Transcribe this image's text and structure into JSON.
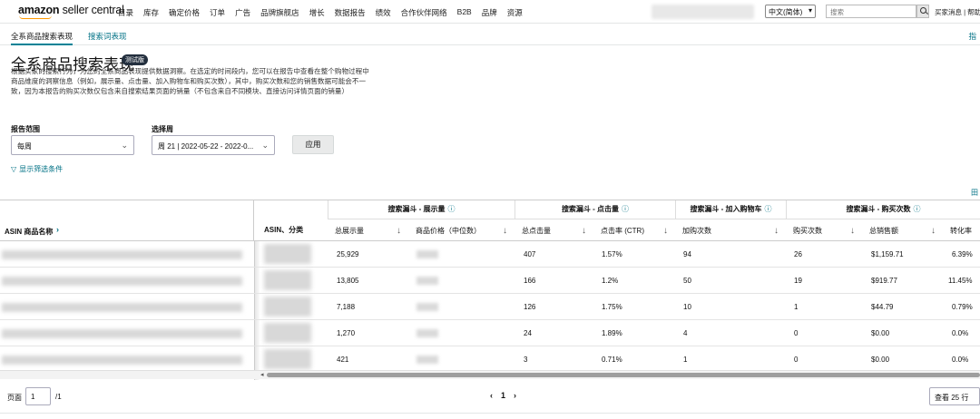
{
  "nav": {
    "logo_brand": "amazon",
    "logo_product": "seller central",
    "menu": [
      "目录",
      "库存",
      "确定价格",
      "订单",
      "广告",
      "品牌旗舰店",
      "增长",
      "数据报告",
      "绩效",
      "合作伙伴网络",
      "B2B",
      "品牌",
      "资源"
    ],
    "language": "中文(简体)",
    "search_placeholder": "搜索",
    "right_links": "买家消息 | 帮助"
  },
  "subnav": {
    "tabs": [
      "全系商品搜索表现",
      "搜索词表现"
    ],
    "active_tab": 0,
    "right_link": "指"
  },
  "header": {
    "title": "全系商品搜索表现",
    "badge": "测试版",
    "description": "根据买家的搜索行为，为您的全系商品表现提供数据洞察。在选定的时间段内，您可以在报告中查看在整个购物过程中商品维度的洞察信息（例如，展示量、点击量、加入购物车和购买次数），其中，购买次数和您的销售数据可能会不一致，因为本报告的购买次数仅包含来自搜索结果页面的销量（不包含来自不同模块、直接访问详情页面的销量）"
  },
  "filters": {
    "range_label": "报告范围",
    "range_value": "每周",
    "week_label": "选择周",
    "week_value": "周 21 | 2022-05-22 - 2022-0...",
    "apply_label": "应用",
    "show_filters_label": "显示筛选条件",
    "grid_icon_label": "田"
  },
  "table": {
    "asin_header": "ASIN 商品名称",
    "category_header": "ASIN、分类",
    "groups": [
      {
        "label": "搜索漏斗 - 展示量"
      },
      {
        "label": "搜索漏斗 - 点击量"
      },
      {
        "label": "搜索漏斗 - 加入购物车"
      },
      {
        "label": "搜索漏斗 - 购买次数"
      }
    ],
    "columns": [
      "总展示量",
      "商品价格（中位数）",
      "总点击量",
      "点击率 (CTR)",
      "加购次数",
      "购买次数",
      "总销售额",
      "转化率"
    ],
    "rows": [
      {
        "impressions": "25,929",
        "clicks": "407",
        "ctr": "1.57%",
        "cart_adds": "94",
        "purchases": "26",
        "sales": "$1,159.71",
        "conversion": "6.39%"
      },
      {
        "impressions": "13,805",
        "clicks": "166",
        "ctr": "1.2%",
        "cart_adds": "50",
        "purchases": "19",
        "sales": "$919.77",
        "conversion": "11.45%"
      },
      {
        "impressions": "7,188",
        "clicks": "126",
        "ctr": "1.75%",
        "cart_adds": "10",
        "purchases": "1",
        "sales": "$44.79",
        "conversion": "0.79%"
      },
      {
        "impressions": "1,270",
        "clicks": "24",
        "ctr": "1.89%",
        "cart_adds": "4",
        "purchases": "0",
        "sales": "$0.00",
        "conversion": "0.0%"
      },
      {
        "impressions": "421",
        "clicks": "3",
        "ctr": "0.71%",
        "cart_adds": "1",
        "purchases": "0",
        "sales": "$0.00",
        "conversion": "0.0%"
      }
    ]
  },
  "footer": {
    "page_label": "页面",
    "page_value": "1",
    "page_total": "/1",
    "pager_prev": "‹",
    "pager_current": "1",
    "pager_next": "›",
    "per_page": "查看 25 行"
  },
  "colors": {
    "link": "#007185",
    "accent_underline": "#008296",
    "logo_smile": "#ff9900",
    "badge_bg": "#232f3e"
  }
}
